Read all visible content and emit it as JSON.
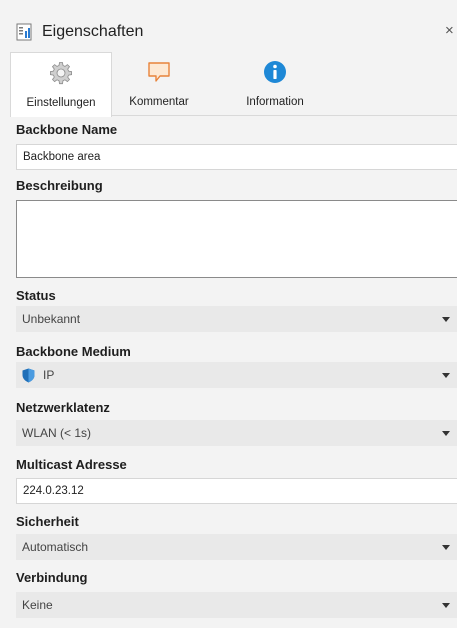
{
  "panel": {
    "title": "Eigenschaften",
    "close_glyph": "×",
    "icon": "properties-icon"
  },
  "tabs": [
    {
      "label": "Einstellungen",
      "icon": "gear-icon",
      "active": true
    },
    {
      "label": "Kommentar",
      "icon": "comment-icon",
      "active": false
    },
    {
      "label": "Information",
      "icon": "info-icon",
      "active": false
    }
  ],
  "form": {
    "backbone_name": {
      "label": "Backbone Name",
      "value": "Backbone area"
    },
    "beschreibung": {
      "label": "Beschreibung",
      "value": ""
    },
    "status": {
      "label": "Status",
      "value": "Unbekannt"
    },
    "backbone_medium": {
      "label": "Backbone Medium",
      "value": "IP",
      "icon": "shield-icon"
    },
    "netzwerklatenz": {
      "label": "Netzwerklatenz",
      "value": "WLAN (< 1s)"
    },
    "multicast_adresse": {
      "label": "Multicast Adresse",
      "value": "224.0.23.12"
    },
    "sicherheit": {
      "label": "Sicherheit",
      "value": "Automatisch"
    },
    "verbindung": {
      "label": "Verbindung",
      "value": "Keine"
    }
  },
  "colors": {
    "panel_bg": "#f3f3f3",
    "dropdown_bg": "#e9e9e9",
    "info_blue": "#1e88d6",
    "comment_orange": "#e8833a",
    "shield_blue": "#1f6fb8"
  }
}
